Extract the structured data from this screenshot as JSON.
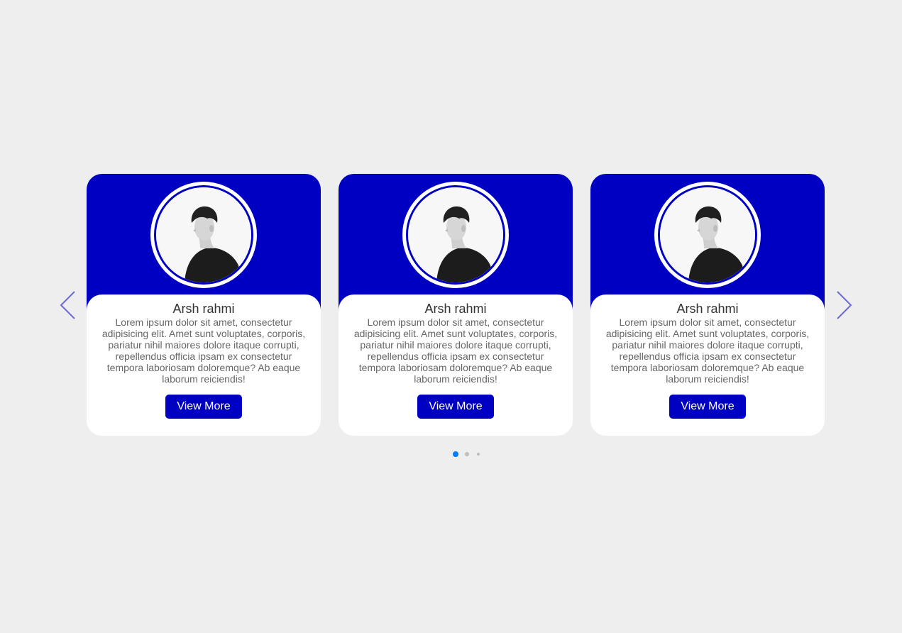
{
  "colors": {
    "background": "#eeeeee",
    "accent": "#0000c2",
    "arrow": "#6b6bd6",
    "dot_active": "#007aff",
    "dot_inactive": "#bdbdbd"
  },
  "navigation": {
    "prev_icon": "chevron-left-icon",
    "next_icon": "chevron-right-icon"
  },
  "cards": [
    {
      "avatar_icon": "profile-photo",
      "name": "Arsh rahmi",
      "description": "Lorem ipsum dolor sit amet, consectetur adipisicing elit. Amet sunt voluptates, corporis, pariatur nihil maiores dolore itaque corrupti, repellendus officia ipsam ex consectetur tempora laboriosam doloremque? Ab eaque laborum reiciendis!",
      "button_label": "View More"
    },
    {
      "avatar_icon": "profile-photo",
      "name": "Arsh rahmi",
      "description": "Lorem ipsum dolor sit amet, consectetur adipisicing elit. Amet sunt voluptates, corporis, pariatur nihil maiores dolore itaque corrupti, repellendus officia ipsam ex consectetur tempora laboriosam doloremque? Ab eaque laborum reiciendis!",
      "button_label": "View More"
    },
    {
      "avatar_icon": "profile-photo",
      "name": "Arsh rahmi",
      "description": "Lorem ipsum dolor sit amet, consectetur adipisicing elit. Amet sunt voluptates, corporis, pariatur nihil maiores dolore itaque corrupti, repellendus officia ipsam ex consectetur tempora laboriosam doloremque? Ab eaque laborum reiciendis!",
      "button_label": "View More"
    }
  ],
  "pagination": {
    "total_dots": 3,
    "active_index": 0
  }
}
